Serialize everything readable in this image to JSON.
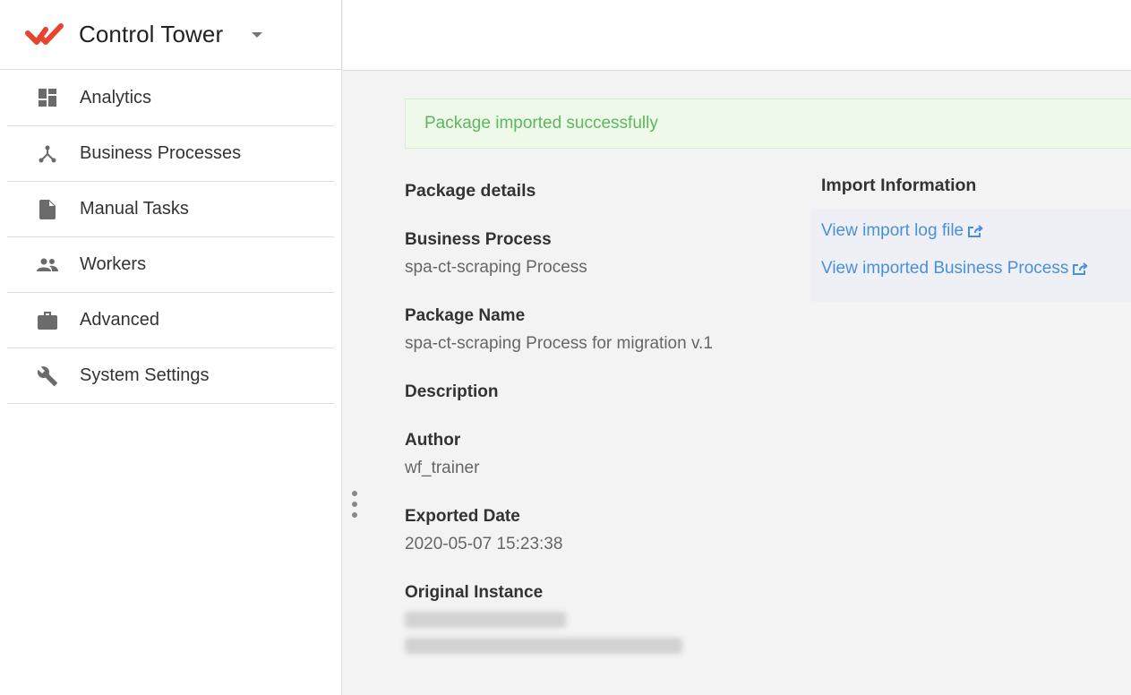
{
  "app": {
    "title": "Control Tower",
    "logo_color": "#e8432d"
  },
  "sidebar": {
    "items": [
      {
        "label": "Analytics",
        "icon": "dashboard-icon"
      },
      {
        "label": "Business Processes",
        "icon": "process-icon"
      },
      {
        "label": "Manual Tasks",
        "icon": "document-icon"
      },
      {
        "label": "Workers",
        "icon": "people-icon"
      },
      {
        "label": "Advanced",
        "icon": "briefcase-icon"
      },
      {
        "label": "System Settings",
        "icon": "wrench-icon"
      }
    ]
  },
  "alert": {
    "message": "Package imported successfully",
    "color": "#5cb85c"
  },
  "package_details": {
    "title": "Package details",
    "business_process_label": "Business Process",
    "business_process_value": "spa-ct-scraping Process",
    "package_name_label": "Package Name",
    "package_name_value": "spa-ct-scraping Process for migration v.1",
    "description_label": "Description",
    "author_label": "Author",
    "author_value": "wf_trainer",
    "exported_date_label": "Exported Date",
    "exported_date_value": "2020-05-07 15:23:38",
    "original_instance_label": "Original Instance"
  },
  "import_info": {
    "title": "Import Information",
    "log_link": "View import log file",
    "process_link": "View imported Business Process",
    "link_color": "#4a90d9"
  }
}
